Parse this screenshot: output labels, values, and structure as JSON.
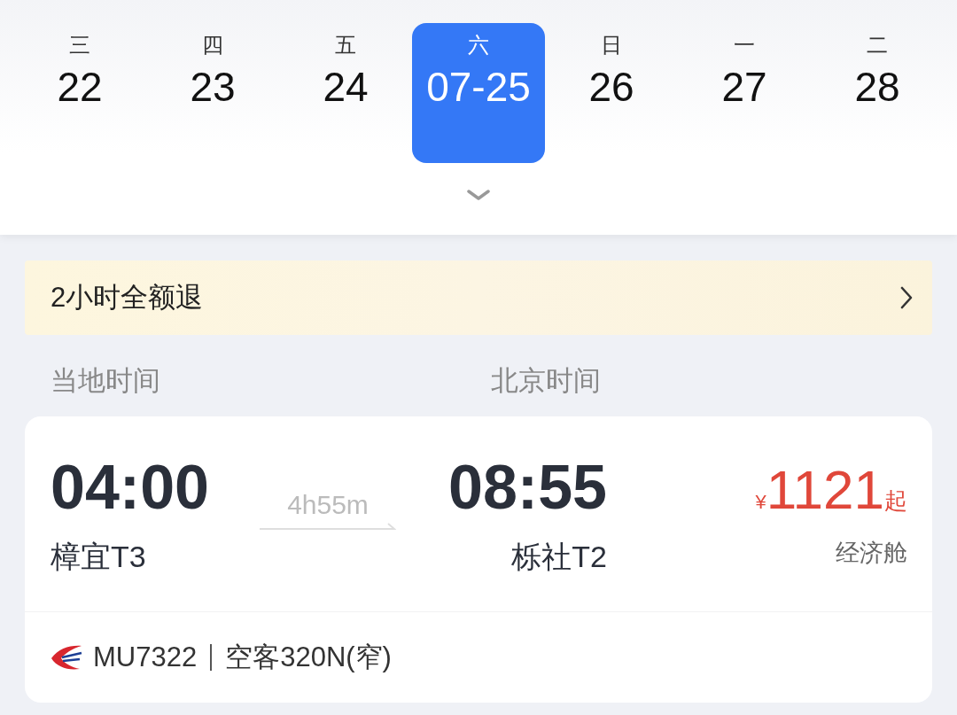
{
  "dates": [
    {
      "weekday": "三",
      "date": "22",
      "selected": false
    },
    {
      "weekday": "四",
      "date": "23",
      "selected": false
    },
    {
      "weekday": "五",
      "date": "24",
      "selected": false
    },
    {
      "weekday": "六",
      "date": "07-25",
      "selected": true
    },
    {
      "weekday": "日",
      "date": "26",
      "selected": false
    },
    {
      "weekday": "一",
      "date": "27",
      "selected": false
    },
    {
      "weekday": "二",
      "date": "28",
      "selected": false
    }
  ],
  "banner": {
    "text": "2小时全额退"
  },
  "time_labels": {
    "departure": "当地时间",
    "arrival": "北京时间"
  },
  "flight": {
    "departure": {
      "time": "04:00",
      "airport": "樟宜T3"
    },
    "duration": "4h55m",
    "arrival": {
      "time": "08:55",
      "airport": "栎社T2"
    },
    "price": {
      "currency": "¥",
      "amount": "1121",
      "suffix": "起",
      "cabin": "经济舱"
    },
    "flight_number": "MU7322",
    "aircraft": "空客320N(窄)"
  }
}
